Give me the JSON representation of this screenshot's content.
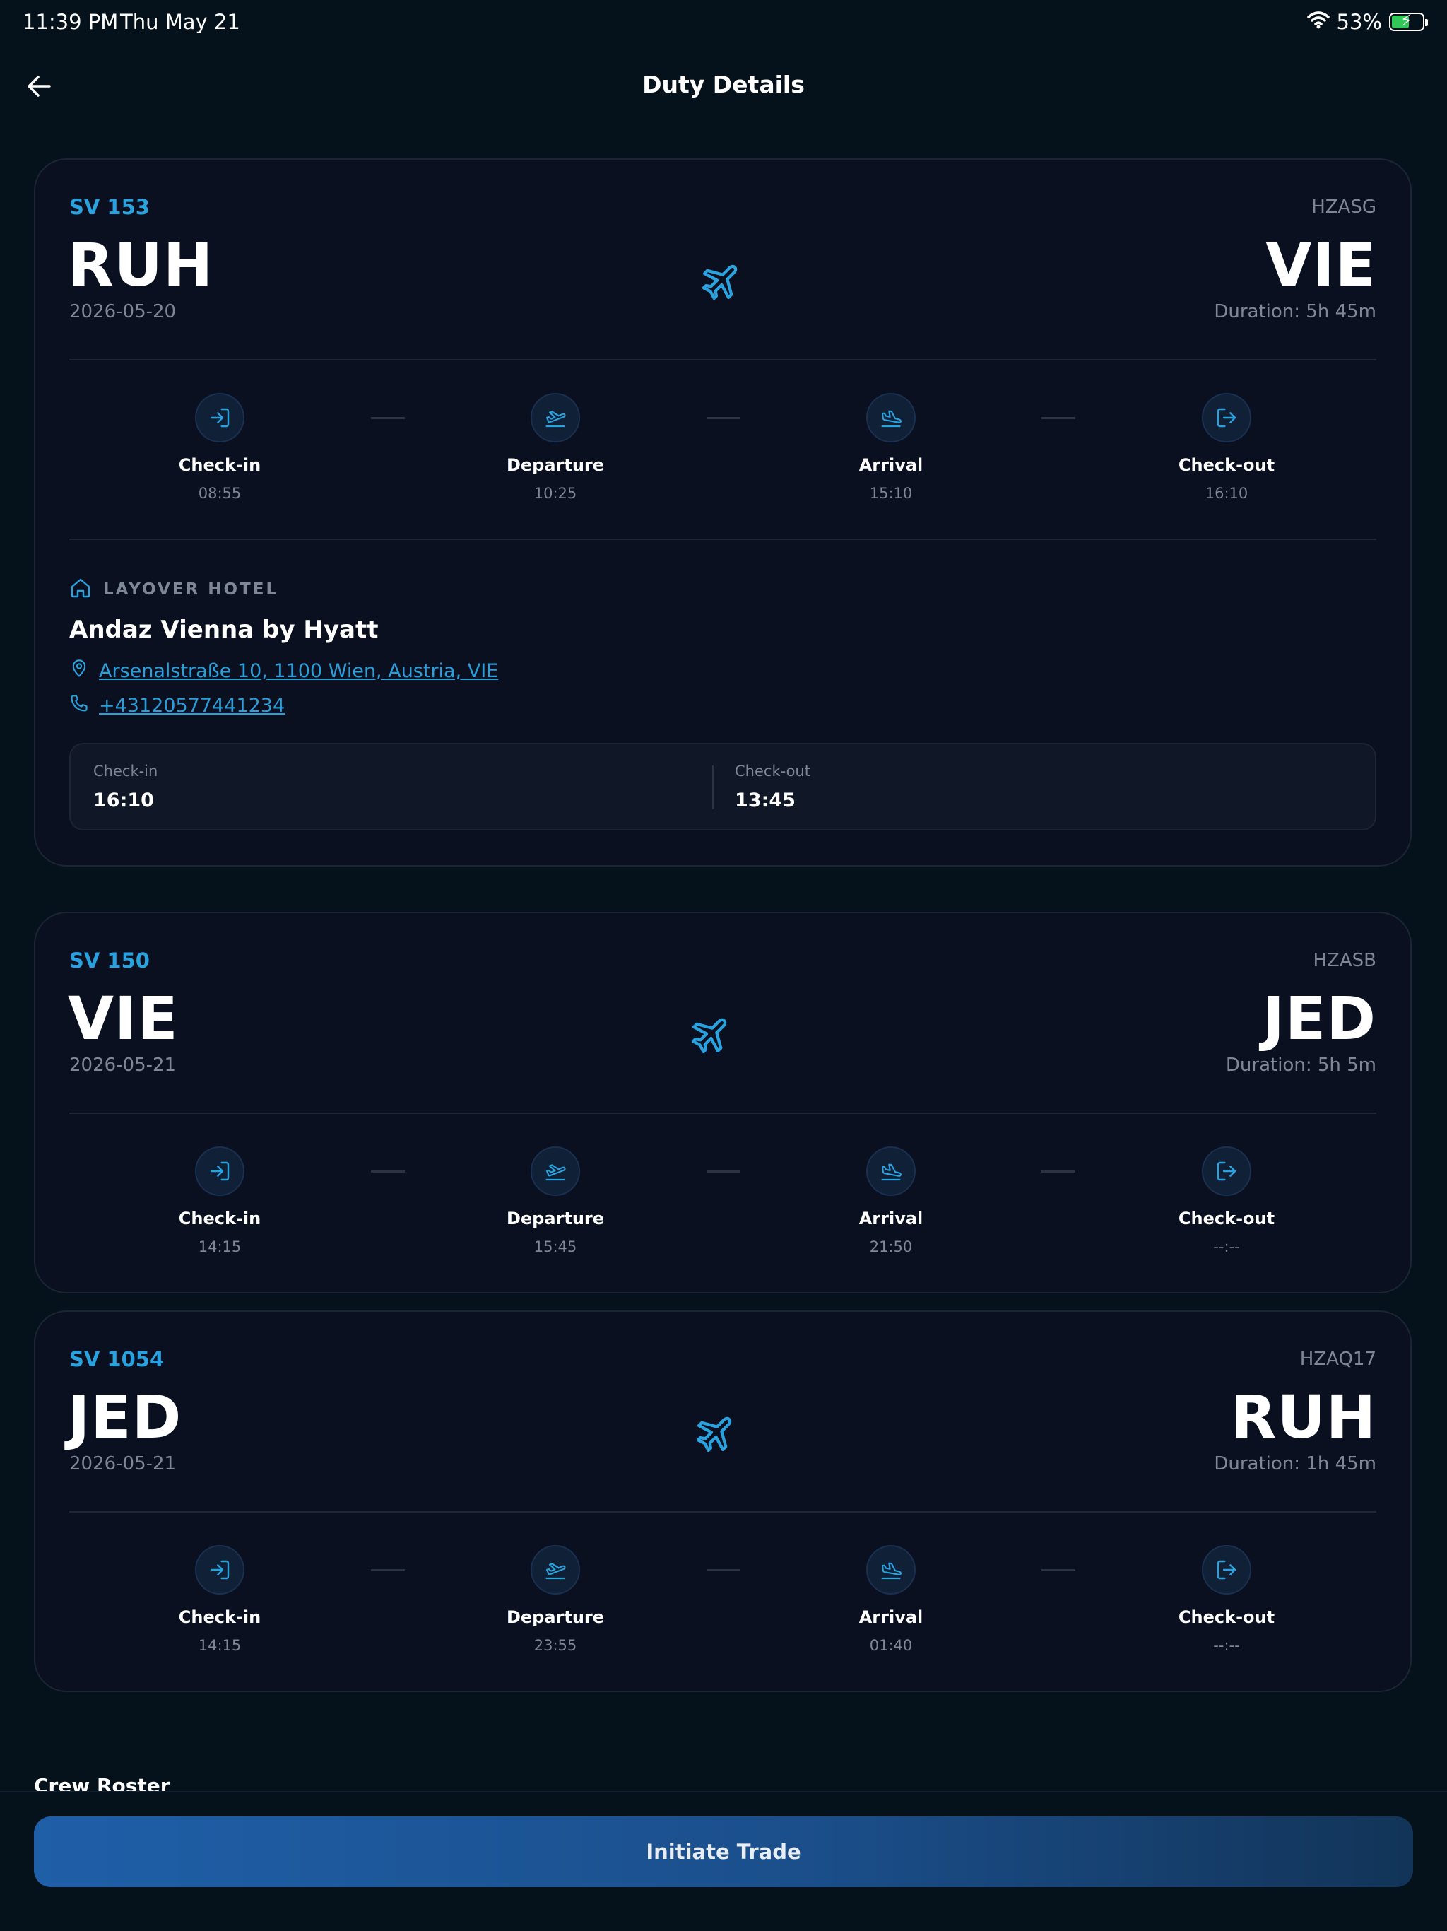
{
  "status_bar": {
    "time": "11:39 PM",
    "date": "Thu May 21",
    "battery": "53%"
  },
  "nav": {
    "title": "Duty Details"
  },
  "flights": [
    {
      "flight_no": "SV 153",
      "registration": "HZASG",
      "origin": "RUH",
      "destination": "VIE",
      "date": "2026-05-20",
      "duration": "Duration: 5h 45m",
      "steps": [
        {
          "label": "Check-in",
          "time": "08:55"
        },
        {
          "label": "Departure",
          "time": "10:25"
        },
        {
          "label": "Arrival",
          "time": "15:10"
        },
        {
          "label": "Check-out",
          "time": "16:10"
        }
      ]
    },
    {
      "flight_no": "SV 150",
      "registration": "HZASB",
      "origin": "VIE",
      "destination": "JED",
      "date": "2026-05-21",
      "duration": "Duration: 5h 5m",
      "steps": [
        {
          "label": "Check-in",
          "time": "14:15"
        },
        {
          "label": "Departure",
          "time": "15:45"
        },
        {
          "label": "Arrival",
          "time": "21:50"
        },
        {
          "label": "Check-out",
          "time": "--:--"
        }
      ]
    },
    {
      "flight_no": "SV 1054",
      "registration": "HZAQ17",
      "origin": "JED",
      "destination": "RUH",
      "date": "2026-05-21",
      "duration": "Duration: 1h 45m",
      "steps": [
        {
          "label": "Check-in",
          "time": "14:15"
        },
        {
          "label": "Departure",
          "time": "23:55"
        },
        {
          "label": "Arrival",
          "time": "01:40"
        },
        {
          "label": "Check-out",
          "time": "--:--"
        }
      ]
    }
  ],
  "hotel": {
    "section_label": "LAYOVER HOTEL",
    "name": "Andaz Vienna by Hyatt",
    "address": "Arsenalstraße 10, 1100 Wien, Austria, VIE",
    "phone": "+43120577441234",
    "checkin_label": "Check-in",
    "checkin_time": "16:10",
    "checkout_label": "Check-out",
    "checkout_time": "13:45"
  },
  "crew_roster": {
    "title": "Crew Roster"
  },
  "actions": {
    "trade_label": "Initiate Trade"
  },
  "colors": {
    "accent": "#29a3e0",
    "background": "#06121b",
    "card": "#0a1020",
    "muted_text": "#7d8797"
  },
  "icons": {
    "back": "arrow-left-icon",
    "plane": "plane-icon",
    "checkin": "login-icon",
    "departure": "plane-takeoff-icon",
    "arrival": "plane-landing-icon",
    "checkout": "logout-icon",
    "hotel": "home-icon",
    "address": "map-pin-icon",
    "phone": "phone-icon"
  }
}
